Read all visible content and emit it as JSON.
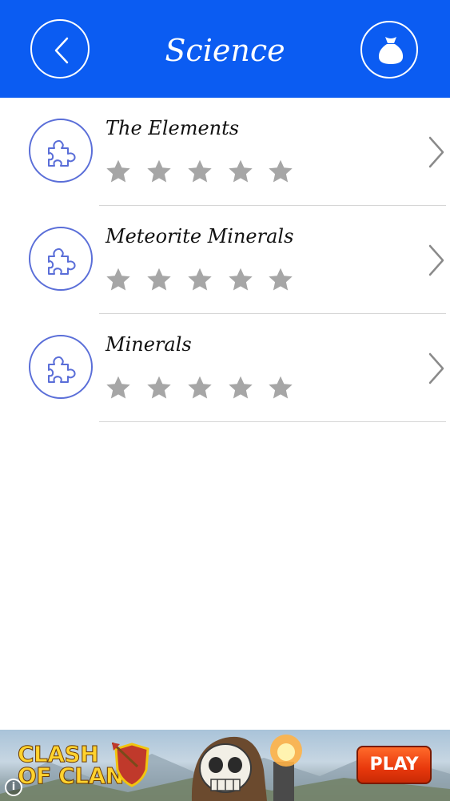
{
  "header": {
    "title": "Science",
    "back_icon": "chevron-left-icon",
    "bag_icon": "coin-bag-icon",
    "background_color": "#0b5cf2"
  },
  "list": {
    "items": [
      {
        "title": "The Elements",
        "icon": "puzzle-piece-icon",
        "stars_earned": 0,
        "stars_total": 5
      },
      {
        "title": "Meteorite Minerals",
        "icon": "puzzle-piece-icon",
        "stars_earned": 0,
        "stars_total": 5
      },
      {
        "title": "Minerals",
        "icon": "puzzle-piece-icon",
        "stars_earned": 0,
        "stars_total": 5
      }
    ],
    "star_color_empty": "#a6a6a6",
    "accent_color": "#5a6ed8"
  },
  "ad": {
    "logo_line1": "CLASH",
    "logo_line2": "OF CLANS",
    "play_label": "PLAY",
    "info_icon": "info-icon",
    "play_color": "#e8380c"
  }
}
